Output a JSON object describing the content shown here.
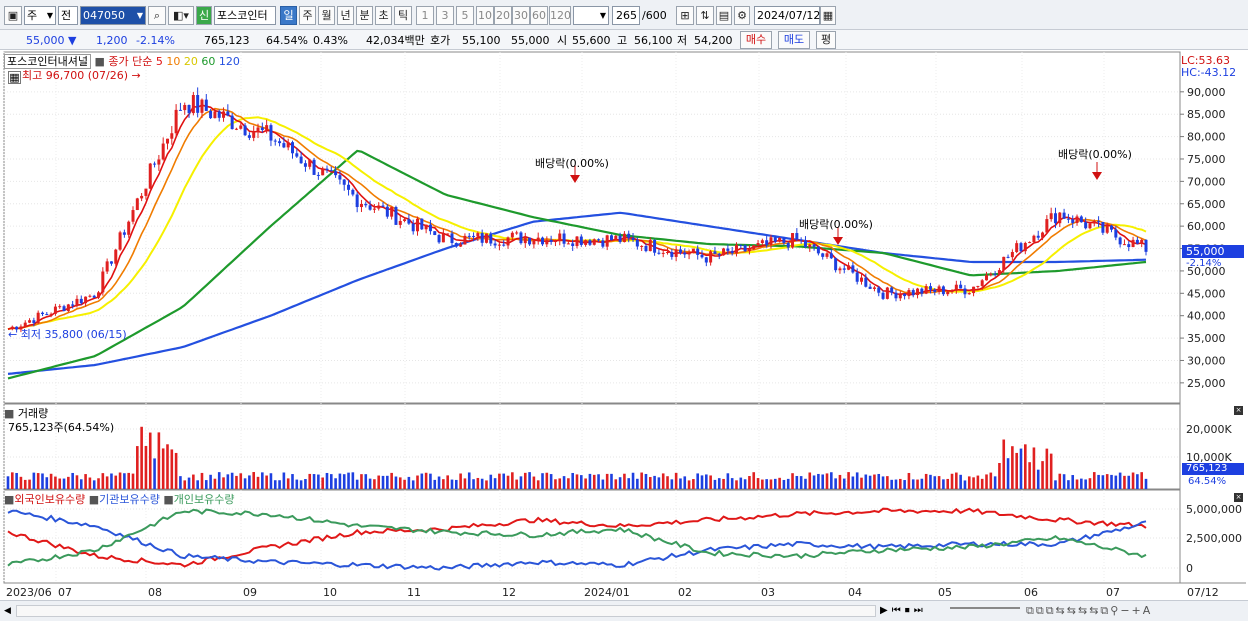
{
  "toolbar": {
    "period_select": "주",
    "type_select": "전",
    "code": "047050",
    "new_badge": "신",
    "stock_name": "포스코인터",
    "periods": [
      "일",
      "주",
      "월",
      "년",
      "분",
      "초",
      "틱"
    ],
    "nums": [
      "1",
      "3",
      "5",
      "10",
      "20",
      "30",
      "60",
      "120"
    ],
    "count": "265",
    "total": "/600",
    "date": "2024/07/12"
  },
  "quote": {
    "price": "55,000",
    "arrow": "▼",
    "change": "1,200",
    "pct": "-2.14%",
    "volume": "765,123",
    "vol_ratio": "64.54%",
    "turnover": "0.43%",
    "amount": "42,034백만",
    "bid_label": "호가",
    "ask": "55,100",
    "bid": "55,000",
    "open_label": "시",
    "open": "55,600",
    "high_label": "고",
    "high": "56,100",
    "low_label": "저",
    "low": "54,200",
    "buy": "매수",
    "sell": "매도",
    "eval": "평"
  },
  "price_panel": {
    "legend_name": "포스코인터내셔널",
    "legend_ma": "종가 단순",
    "ma": [
      "5",
      "10",
      "20",
      "60",
      "120"
    ],
    "max_label": "최고 96,700 (07/26)",
    "min_label": "최저 35,800 (06/15)",
    "events": [
      "배당락(0.00%)",
      "배당락(0.00%)",
      "배당락(0.00%)"
    ],
    "lc": "LC:53.63",
    "hc": "HC:-43.12",
    "yticks": [
      "90,000",
      "85,000",
      "80,000",
      "75,000",
      "70,000",
      "65,000",
      "60,000",
      "55,000",
      "50,000",
      "45,000",
      "40,000",
      "35,000",
      "30,000",
      "25,000"
    ],
    "current_price": "55,000",
    "current_pct": "-2.14%"
  },
  "volume_panel": {
    "title": "거래량",
    "value": "765,123주(64.54%)",
    "yticks": [
      "20,000K",
      "10,000K"
    ],
    "current": "765,123",
    "current_pct": "64.54%"
  },
  "holding_panel": {
    "series": [
      "외국인보유수량",
      "기관보유수량",
      "개인보유수량"
    ],
    "yticks": [
      "5,000,000",
      "2,500,000",
      "0"
    ]
  },
  "xaxis": {
    "labels": [
      "2023/06",
      "07",
      "08",
      "09",
      "10",
      "11",
      "12",
      "2024/01",
      "02",
      "03",
      "04",
      "05",
      "06",
      "07"
    ],
    "right": "07/12"
  },
  "colors": {
    "up": "#e02020",
    "down": "#1d3fe0",
    "ma5": "#e01010",
    "ma10": "#f07c00",
    "ma20": "#f6f000",
    "ma60": "#1e9a2c",
    "ma120": "#2450e0",
    "foreign": "#e01818",
    "inst": "#2a55d8",
    "indiv": "#3b9a5c"
  },
  "chart_data": {
    "type": "line",
    "title": "포스코인터내셔널",
    "x": [
      "2023/06",
      "07",
      "08",
      "09",
      "10",
      "11",
      "12",
      "2024/01",
      "02",
      "03",
      "04",
      "05",
      "06",
      "07"
    ],
    "series": [
      {
        "name": "종가",
        "values": [
          37000,
          45000,
          88000,
          80000,
          66000,
          57000,
          57500,
          57000,
          53000,
          57000,
          45000,
          46000,
          63000,
          55000
        ]
      },
      {
        "name": "120",
        "values": [
          27000,
          29000,
          33000,
          40000,
          48000,
          55000,
          61000,
          63000,
          60000,
          57000,
          54000,
          52000,
          52000,
          52500
        ]
      },
      {
        "name": "60",
        "values": [
          26000,
          31000,
          42000,
          60000,
          77000,
          67000,
          62000,
          58000,
          56000,
          55500,
          54000,
          49000,
          50000,
          52000
        ]
      }
    ],
    "ylim": [
      22000,
      97000
    ],
    "ylabel": ""
  }
}
